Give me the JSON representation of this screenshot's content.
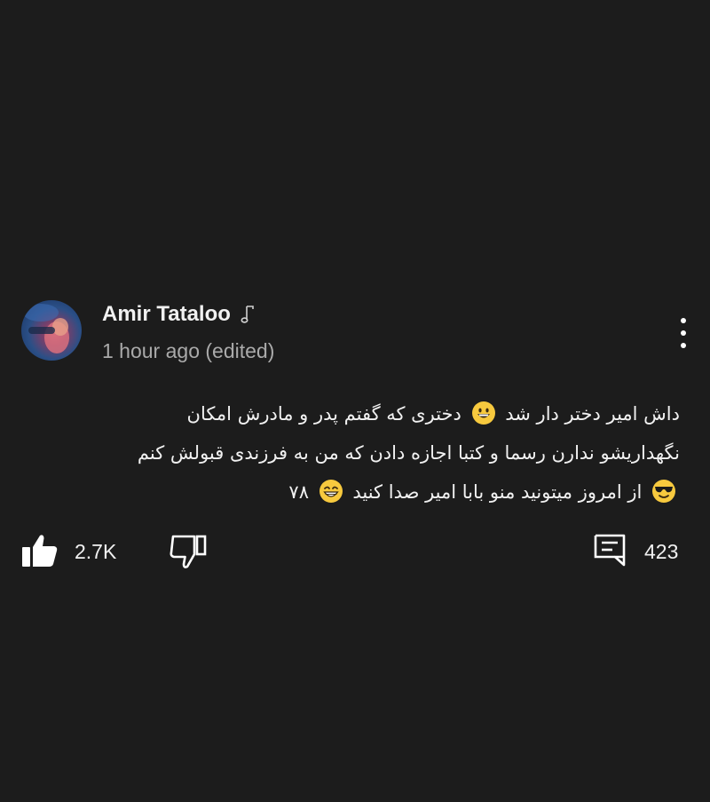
{
  "comment": {
    "author": "Amir Tataloo",
    "author_badge_icon": "music-note-icon",
    "timestamp": "1 hour ago (edited)",
    "text": {
      "line1_a": "داش امیر دختر دار شد",
      "line1_b": "دختری که گفتم پدر و مادرش امکان",
      "line2": "نگهداریشو ندارن رسما و کتبا اجازه دادن که من به فرزندی قبولش کنم",
      "line3_a": "از امروز میتونید منو بابا امیر صدا کنید",
      "line3_b": "۷۸"
    },
    "emojis": [
      "grinning-face",
      "smiling-face-with-sunglasses",
      "beaming-face"
    ],
    "likes": "2.7K",
    "replies": "423",
    "menu_icon": "more-vert-icon"
  },
  "colors": {
    "background": "#1c1c1c",
    "text": "#f1f1f1",
    "secondary_text": "#aaaaaa",
    "emoji_yellow": "#f7c93e"
  }
}
